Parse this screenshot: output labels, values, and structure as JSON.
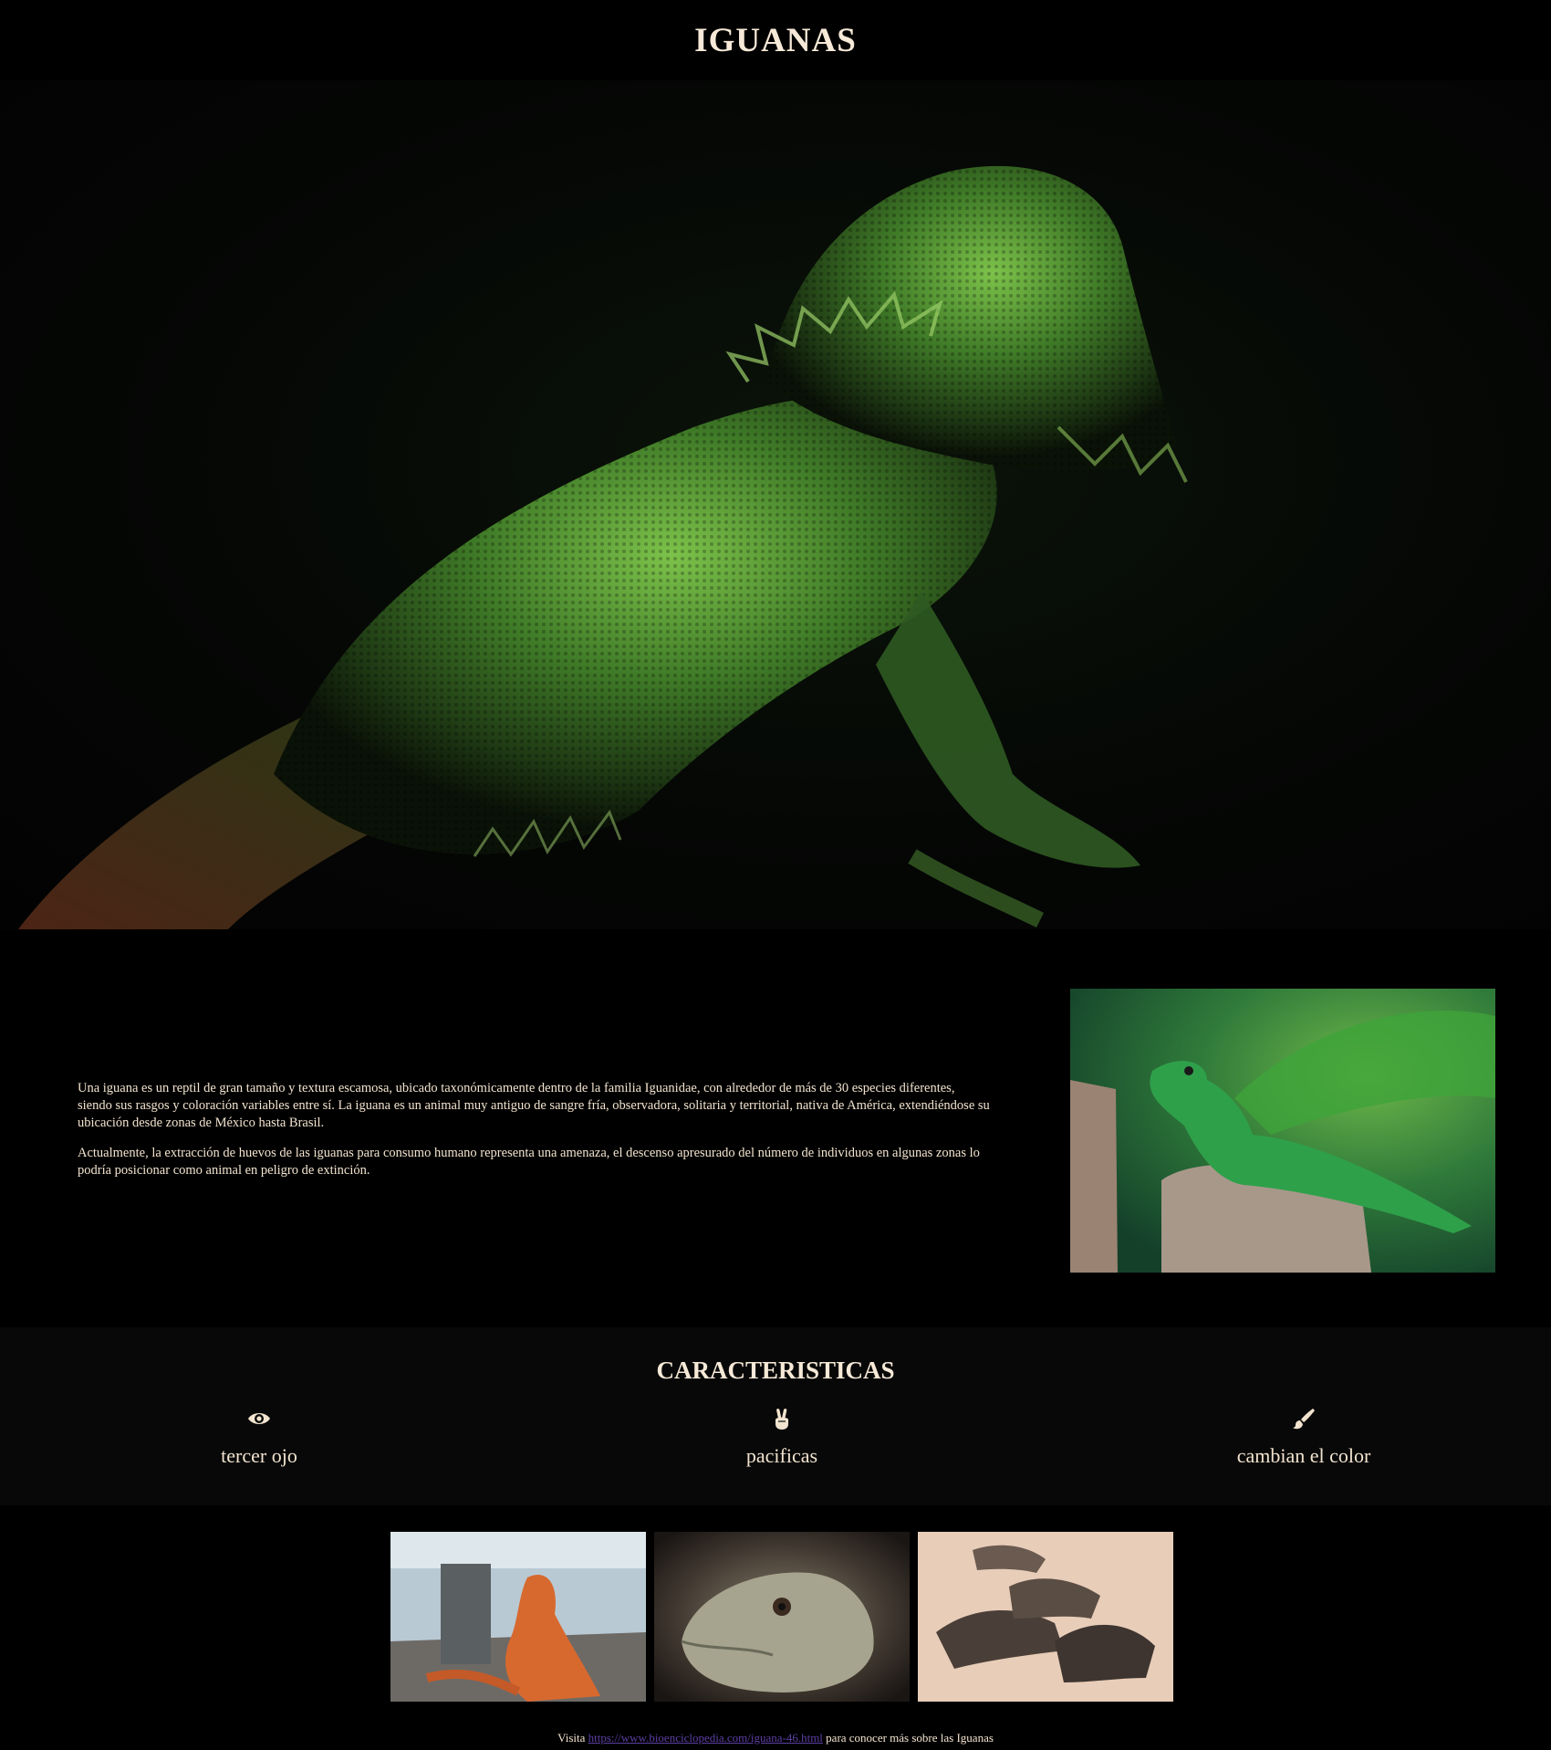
{
  "header": {
    "title": "IGUANAS"
  },
  "hero": {
    "alt": "Iguana verde sobre fondo oscuro"
  },
  "intro": {
    "paragraphs": [
      "Una iguana es un reptil de gran tamaño y textura escamosa, ubicado taxonómicamente dentro de la familia Iguanidae, con alrededor de más de 30 especies diferentes, siendo sus rasgos y coloración variables entre sí. La iguana es un animal muy antiguo de sangre fría, observadora, solitaria y territorial, nativa de América, extendiéndose su ubicación desde zonas de México hasta Brasil.",
      "Actualmente, la extracción de huevos de las iguanas para consumo humano representa una amenaza, el descenso apresurado del número de individuos en algunas zonas lo podría posicionar como animal en peligro de extinción."
    ]
  },
  "features": {
    "title": "CARACTERISTICAS",
    "items": [
      {
        "label": "tercer ojo",
        "icon": "eye-icon"
      },
      {
        "label": "pacificas",
        "icon": "peace-hand-icon"
      },
      {
        "label": "cambian el color",
        "icon": "paint-brush-icon"
      }
    ]
  },
  "footer": {
    "prefix": "Visita",
    "link_text": "https://www.bioenciclopedia.com/iguana-46.html",
    "suffix": "para conocer más sobre las Iguanas"
  },
  "colors": {
    "text": "#f3e4cf",
    "link": "#5b3fa3",
    "section_bg": "#080808"
  }
}
